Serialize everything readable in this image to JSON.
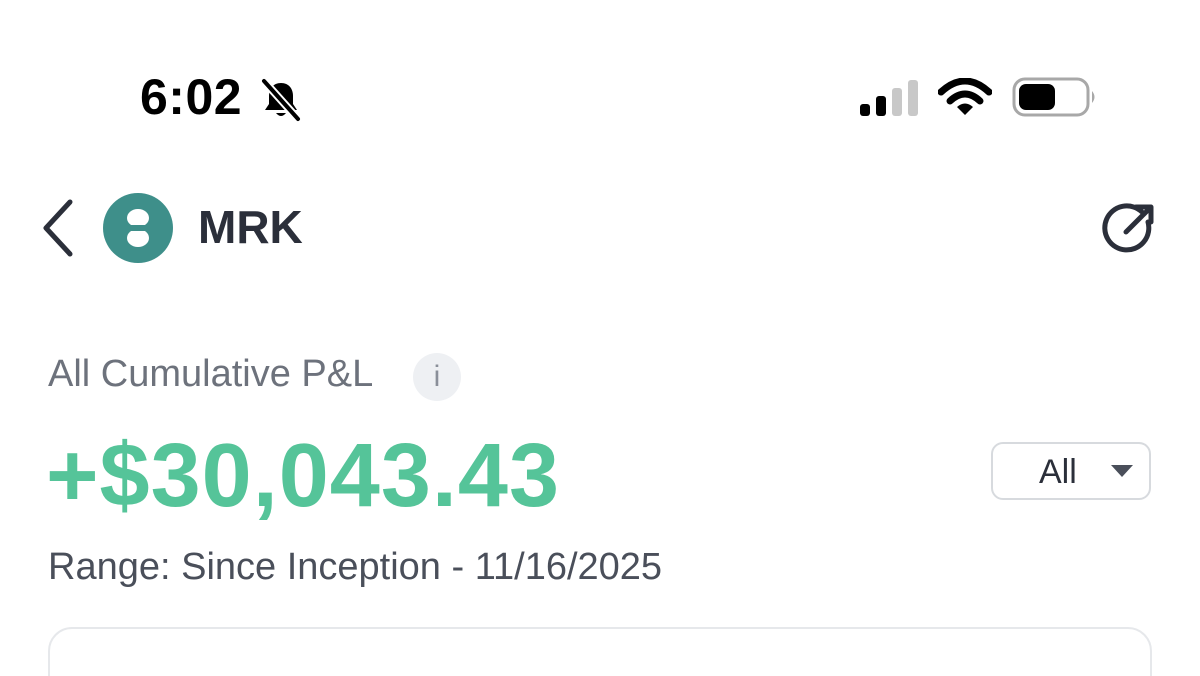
{
  "status_bar": {
    "time": "6:02",
    "icons": [
      "bell-slash-icon",
      "cellular-signal-icon",
      "wifi-icon",
      "battery-icon"
    ]
  },
  "header": {
    "ticker": "MRK",
    "logo_color": "#3e8f8a",
    "icons": [
      "chevron-left-icon",
      "share-icon"
    ]
  },
  "pnl": {
    "label": "All Cumulative P&L",
    "info_glyph": "i",
    "value": "+$30,043.43",
    "value_color": "#55c499",
    "range_selector": {
      "selected": "All"
    },
    "range_text": "Range: Since Inception - 11/16/2025"
  }
}
